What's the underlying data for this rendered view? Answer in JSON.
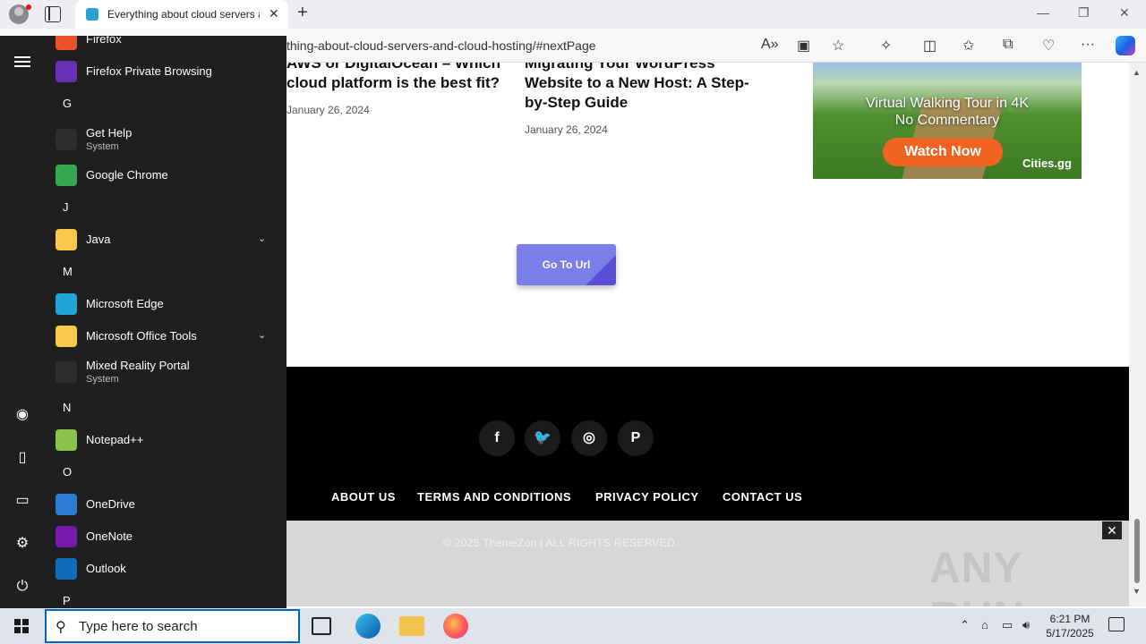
{
  "browser": {
    "tab_title": "Everything about cloud servers a",
    "address": "thing-about-cloud-servers-and-cloud-hosting/#nextPage"
  },
  "page": {
    "post1": {
      "title_line1": "AWS or DigitalOcean – Which",
      "title_line2": "cloud platform is the best fit?",
      "date": "January 26, 2024"
    },
    "post2": {
      "title_line1": "Migrating Your WordPress",
      "title_line2": "Website to a New Host: A Step-",
      "title_line3": "by-Step Guide",
      "date": "January 26, 2024"
    },
    "ad": {
      "line1": "Virtual Walking Tour in 4K",
      "line2": "No Commentary",
      "button": "Watch Now",
      "brand": "Cities.gg"
    },
    "goto_button": "Go To Url",
    "footer": {
      "social": [
        "f",
        "t",
        "ig",
        "p"
      ],
      "nav": [
        "ABOUT US",
        "TERMS AND CONDITIONS",
        "PRIVACY POLICY",
        "CONTACT US"
      ],
      "copyright": "© 2025 ThemeZon | ALL RIGHTS RESERVED."
    },
    "watermark": "ANY RUN"
  },
  "start_menu": {
    "apps": [
      {
        "name": "Firefox",
        "color": "#e8532c"
      },
      {
        "name": "Firefox Private Browsing",
        "color": "#6a2fb8"
      },
      {
        "letter": "G"
      },
      {
        "name": "Get Help",
        "sub": "System",
        "color": "#2d2d2d"
      },
      {
        "name": "Google Chrome",
        "color": "#34a853"
      },
      {
        "letter": "J"
      },
      {
        "name": "Java",
        "color": "#f7c948",
        "expand": true
      },
      {
        "letter": "M"
      },
      {
        "name": "Microsoft Edge",
        "color": "#1fa5d8"
      },
      {
        "name": "Microsoft Office Tools",
        "color": "#f7c948",
        "expand": true
      },
      {
        "name": "Mixed Reality Portal",
        "sub": "System",
        "color": "#2d2d2d"
      },
      {
        "letter": "N"
      },
      {
        "name": "Notepad++",
        "color": "#8bc34a"
      },
      {
        "letter": "O"
      },
      {
        "name": "OneDrive",
        "color": "#2b7cd3"
      },
      {
        "name": "OneNote",
        "color": "#7719aa"
      },
      {
        "name": "Outlook",
        "color": "#0f6cbd"
      },
      {
        "letter": "P"
      }
    ]
  },
  "taskbar": {
    "search_placeholder": "Type here to search",
    "time": "6:21 PM",
    "date": "5/17/2025"
  }
}
